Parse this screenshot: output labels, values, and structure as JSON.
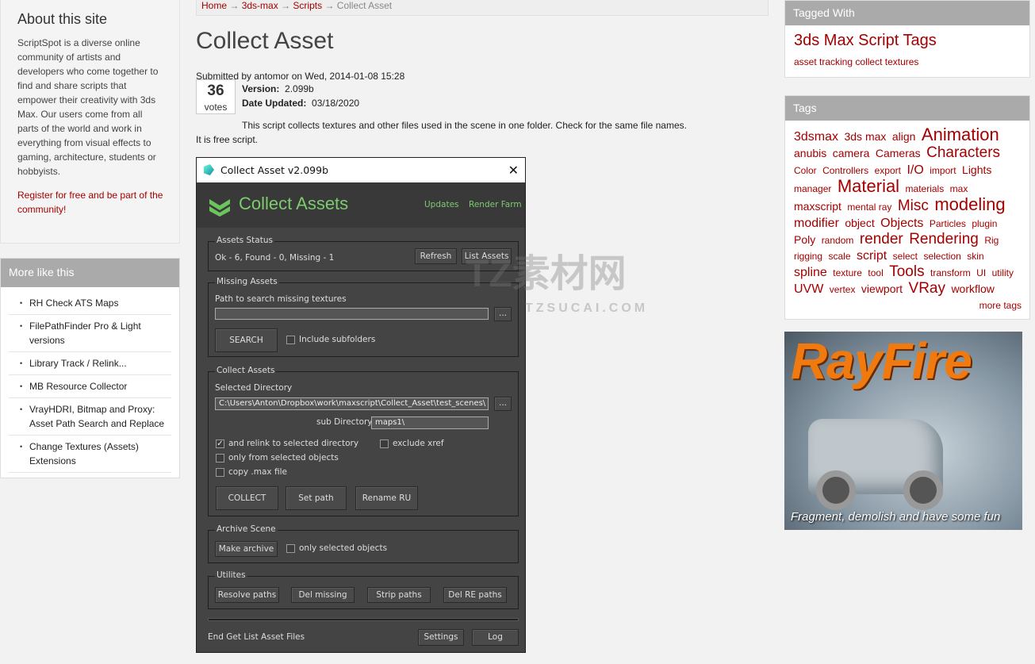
{
  "about": {
    "title": "About this site",
    "text": "ScriptSpot is a diverse online community of artists and developers who come together to find and share scripts that empower their creativity with 3ds Max. Our users come from all parts of the world and work in everything from visual effects to gaming, architecture, students or hobbyists.",
    "register": "Register for free and be part of the community!"
  },
  "more_like_this": {
    "title": "More like this",
    "items": [
      "RH Check ATS Maps",
      "FilePathFinder Pro & Light versions",
      "Library Track / Relink...",
      "MB Resource Collector",
      "VrayHDRI, Bitmap and Proxy: Asset Path Search and Replace",
      "Change Textures (Assets) Extensions"
    ]
  },
  "breadcrumb": {
    "items": [
      "Home",
      "3ds-max",
      "Scripts"
    ],
    "current": "Collect Asset",
    "sep": "→"
  },
  "page": {
    "title": "Collect Asset",
    "submitted": "Submitted by antomor on Wed, 2014-01-08 15:28",
    "votes": "36",
    "votes_label": "votes",
    "version_label": "Version:",
    "version": "2.099b",
    "updated_label": "Date Updated:",
    "updated": "03/18/2020",
    "description": "This script collects textures and other files used in the scene in one folder. Check for the same file names.",
    "free": "It is free script."
  },
  "dialog": {
    "title": "Collect Asset v2.099b",
    "header": "Collect Assets",
    "updates": "Updates",
    "render_farm": "Render Farm",
    "status": {
      "legend": "Assets Status",
      "text": "Ok - 6, Found - 0, Missing - 1",
      "refresh": "Refresh",
      "list": "List Assets"
    },
    "missing": {
      "legend": "Missing Assets",
      "path_label": "Path to search missing textures",
      "path_value": "",
      "browse": "...",
      "search": "SEARCH",
      "subfolders": "Include subfolders",
      "subfolders_checked": false
    },
    "collect": {
      "legend": "Collect Assets",
      "dir_label": "Selected Directory",
      "dir_value": "C:\\Users\\Anton\\Dropbox\\work\\maxscript\\Collect_Asset\\test_scenes\\",
      "browse": "...",
      "subdir_label": "sub Directory",
      "subdir_value": "maps1\\",
      "relink": "and relink to selected directory",
      "relink_checked": true,
      "exclude_xref": "exclude xref",
      "exclude_checked": false,
      "only_selected": "only from selected objects",
      "only_checked": false,
      "copy_max": "copy .max file",
      "copy_checked": false,
      "collect_btn": "COLLECT",
      "set_path": "Set path",
      "rename": "Rename RU"
    },
    "archive": {
      "legend": "Archive Scene",
      "make": "Make archive",
      "only_selected": "only selected objects",
      "only_checked": false
    },
    "utilites": {
      "legend": "Utilites",
      "resolve": "Resolve paths",
      "del_missing": "Del missing",
      "strip": "Strip paths",
      "del_re": "Del RE paths"
    },
    "footer": {
      "status": "End Get List Asset Files",
      "settings": "Settings",
      "log": "Log"
    }
  },
  "tagged": {
    "title": "Tagged With",
    "heading": "3ds Max Script Tags",
    "tags": [
      "asset tracking",
      "collect textures"
    ]
  },
  "tags": {
    "title": "Tags",
    "more": "more tags",
    "items": [
      {
        "t": "3dsmax",
        "w": 3
      },
      {
        "t": "3ds max",
        "w": 2
      },
      {
        "t": "align",
        "w": 2
      },
      {
        "t": "Animation",
        "w": 5
      },
      {
        "t": "anubis",
        "w": 2
      },
      {
        "t": "camera",
        "w": 2
      },
      {
        "t": "Cameras",
        "w": 2
      },
      {
        "t": "Characters",
        "w": 4
      },
      {
        "t": "Color",
        "w": 1
      },
      {
        "t": "Controllers",
        "w": 1
      },
      {
        "t": "export",
        "w": 1
      },
      {
        "t": "I/O",
        "w": 3
      },
      {
        "t": "import",
        "w": 1
      },
      {
        "t": "Lights",
        "w": 2
      },
      {
        "t": "manager",
        "w": 1
      },
      {
        "t": "Material",
        "w": 5
      },
      {
        "t": "materials",
        "w": 1
      },
      {
        "t": "max",
        "w": 1
      },
      {
        "t": "maxscript",
        "w": 2
      },
      {
        "t": "mental ray",
        "w": 1
      },
      {
        "t": "Misc",
        "w": 4
      },
      {
        "t": "modeling",
        "w": 5
      },
      {
        "t": "modifier",
        "w": 3
      },
      {
        "t": "object",
        "w": 2
      },
      {
        "t": "Objects",
        "w": 3
      },
      {
        "t": "Particles",
        "w": 1
      },
      {
        "t": "plugin",
        "w": 1
      },
      {
        "t": "Poly",
        "w": 2
      },
      {
        "t": "random",
        "w": 1
      },
      {
        "t": "render",
        "w": 4
      },
      {
        "t": "Rendering",
        "w": 4
      },
      {
        "t": "Rig",
        "w": 1
      },
      {
        "t": "rigging",
        "w": 1
      },
      {
        "t": "scale",
        "w": 1
      },
      {
        "t": "script",
        "w": 3
      },
      {
        "t": "select",
        "w": 1
      },
      {
        "t": "selection",
        "w": 1
      },
      {
        "t": "skin",
        "w": 1
      },
      {
        "t": "spline",
        "w": 3
      },
      {
        "t": "texture",
        "w": 1
      },
      {
        "t": "tool",
        "w": 1
      },
      {
        "t": "Tools",
        "w": 4
      },
      {
        "t": "transform",
        "w": 1
      },
      {
        "t": "UI",
        "w": 1
      },
      {
        "t": "utility",
        "w": 1
      },
      {
        "t": "UVW",
        "w": 3
      },
      {
        "t": "vertex",
        "w": 1
      },
      {
        "t": "viewport",
        "w": 2
      },
      {
        "t": "VRay",
        "w": 4
      },
      {
        "t": "workflow",
        "w": 2
      }
    ]
  },
  "ad": {
    "brand": "RayFire",
    "tagline": "Fragment, demolish and have some fun"
  },
  "watermark": {
    "text": "TZ素材网",
    "sub": "TZSUCAI.COM"
  }
}
